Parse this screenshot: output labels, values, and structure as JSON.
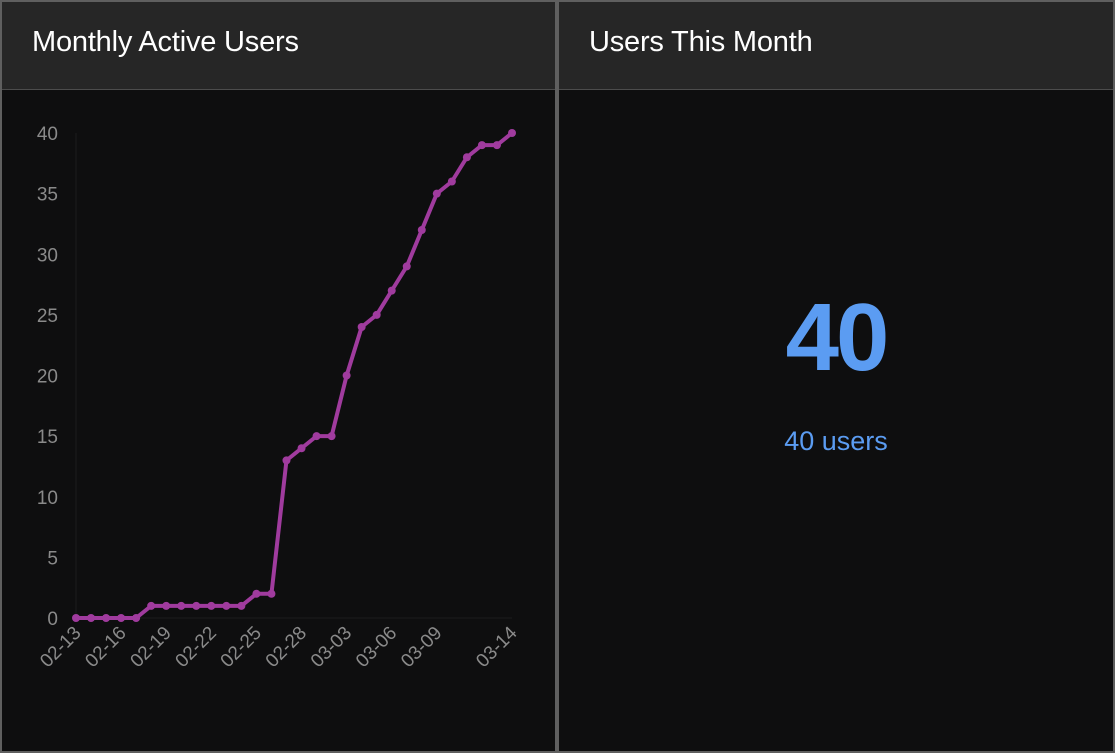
{
  "left_panel": {
    "title": "Monthly Active Users"
  },
  "right_panel": {
    "title": "Users This Month",
    "value": "40",
    "caption": "40 users"
  },
  "colors": {
    "series": "#a03b9e",
    "kpi": "#5b9cf2",
    "background": "#0e0e0f",
    "header": "#262626"
  },
  "chart_data": {
    "type": "line",
    "title": "Monthly Active Users",
    "xlabel": "",
    "ylabel": "",
    "ylim": [
      0,
      40
    ],
    "yticks": [
      0,
      5,
      10,
      15,
      20,
      25,
      30,
      35,
      40
    ],
    "xtick_labels": [
      "02-13",
      "02-16",
      "02-19",
      "02-22",
      "02-25",
      "02-28",
      "03-03",
      "03-06",
      "03-09",
      "03-14"
    ],
    "grid": false,
    "legend": "none",
    "series": [
      {
        "x": [
          "02-13",
          "02-14",
          "02-15",
          "02-16",
          "02-17",
          "02-18",
          "02-19",
          "02-20",
          "02-21",
          "02-22",
          "02-23",
          "02-24",
          "02-25",
          "02-26",
          "02-27",
          "02-28",
          "03-01",
          "03-02",
          "03-03",
          "03-04",
          "03-05",
          "03-06",
          "03-07",
          "03-08",
          "03-09",
          "03-10",
          "03-11",
          "03-12",
          "03-13",
          "03-14"
        ],
        "values": [
          0,
          0,
          0,
          0,
          0,
          1,
          1,
          1,
          1,
          1,
          1,
          1,
          2,
          2,
          13,
          14,
          15,
          15,
          20,
          24,
          25,
          27,
          29,
          32,
          35,
          36,
          38,
          39,
          39,
          40
        ]
      }
    ]
  }
}
